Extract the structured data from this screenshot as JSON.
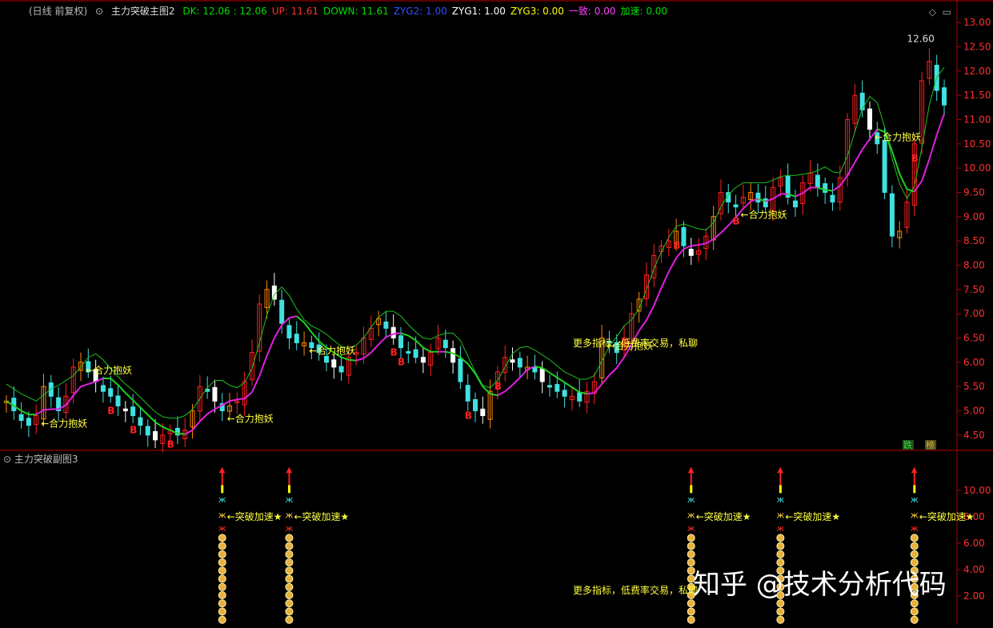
{
  "header": {
    "period": "(日线 前复权)",
    "indicator": "主力突破主图2",
    "fields": [
      {
        "label": "DK: 12.06 : 12.06",
        "color": "#00e000"
      },
      {
        "label": "UP: 11.61",
        "color": "#ff3030"
      },
      {
        "label": "DOWN: 11.61",
        "color": "#00e000"
      },
      {
        "label": "ZYG2: 1.00",
        "color": "#3050ff"
      },
      {
        "label": "ZYG1: 1.00",
        "color": "#ffffff"
      },
      {
        "label": "ZYG3: 0.00",
        "color": "#ffff00"
      },
      {
        "label": "一致: 0.00",
        "color": "#ff40ff"
      },
      {
        "label": "加速: 0.00",
        "color": "#00e000"
      }
    ]
  },
  "sub_header": {
    "indicator": "主力突破副图3"
  },
  "watermark": "知乎 @技术分析代码",
  "chart_data": [
    {
      "type": "line",
      "panel": "main",
      "y_ticks": [
        "13.00",
        "12.50",
        "12.00",
        "11.50",
        "11.00",
        "10.50",
        "10.00",
        "9.50",
        "9.00",
        "8.50",
        "8.00",
        "7.50",
        "7.00",
        "6.50",
        "6.00",
        "5.50",
        "5.00",
        "4.50"
      ],
      "ylim": [
        4.2,
        13.2
      ],
      "max_label": "12.60",
      "series": [
        {
          "values": [
            5.2,
            5.0,
            4.8,
            4.7,
            4.9,
            5.5,
            5.3,
            5.0,
            5.3,
            5.9,
            6.0,
            5.8,
            5.6,
            5.4,
            5.3,
            5.1,
            5.0,
            4.9,
            4.7,
            4.5,
            4.4,
            4.5,
            4.6,
            4.5,
            4.6,
            5.0,
            5.5,
            5.4,
            5.2,
            5.0,
            5.1,
            5.2,
            5.6,
            6.2,
            7.2,
            7.5,
            7.3,
            6.8,
            6.5,
            6.4,
            6.4,
            6.3,
            6.2,
            6.0,
            5.9,
            5.8,
            6.1,
            6.2,
            6.5,
            6.7,
            6.9,
            6.7,
            6.5,
            6.3,
            6.2,
            6.1,
            6.0,
            6.2,
            6.5,
            6.3,
            6.0,
            5.6,
            5.2,
            5.0,
            4.9,
            5.4,
            5.8,
            6.1,
            6.0,
            5.9,
            5.9,
            5.8,
            5.6,
            5.5,
            5.4,
            5.3,
            5.3,
            5.2,
            5.4,
            5.6,
            6.5,
            6.4,
            6.2,
            6.5,
            7.0,
            7.3,
            7.8,
            8.2,
            8.4,
            8.5,
            8.7,
            8.4,
            8.2,
            8.3,
            8.6,
            9.0,
            9.5,
            9.3,
            9.2,
            9.4,
            9.5,
            9.3,
            9.2,
            9.6,
            9.8,
            9.4,
            9.2,
            9.7,
            9.9,
            9.6,
            9.5,
            9.3,
            9.8,
            11.0,
            11.5,
            11.2,
            10.8,
            10.5,
            9.5,
            8.6,
            8.7,
            9.3,
            10.5,
            11.8,
            12.2,
            11.6,
            11.3
          ]
        }
      ],
      "labels": [
        {
          "text": "合力抱妖",
          "at": 4
        },
        {
          "text": "合力抱妖",
          "at": 10
        },
        {
          "text": "合力抱妖",
          "at": 29
        },
        {
          "text": "合力抱妖",
          "at": 40
        },
        {
          "text": "合力抱妖",
          "at": 80
        },
        {
          "text": "合力抱妖",
          "at": 98
        },
        {
          "text": "合力抱妖",
          "at": 116
        }
      ],
      "b_markers": [
        14,
        17,
        22,
        52,
        53,
        62,
        66,
        90,
        98,
        122
      ],
      "annotation": "更多指标，低费率交易，私聊",
      "bottom_tags": [
        "跌",
        "榜"
      ]
    },
    {
      "type": "bar",
      "panel": "sub",
      "y_ticks": [
        "10.00",
        "8.00",
        "6.00",
        "4.00",
        "2.00"
      ],
      "ylim": [
        0,
        12
      ],
      "columns": [
        {
          "at": 29,
          "label": "突破加速★"
        },
        {
          "at": 38,
          "label": "突破加速★"
        },
        {
          "at": 92,
          "label": "突破加速★"
        },
        {
          "at": 104,
          "label": "突破加速★"
        },
        {
          "at": 122,
          "label": "突破加速★"
        }
      ],
      "annotation": "更多指标，低费率交易，私聊"
    }
  ]
}
